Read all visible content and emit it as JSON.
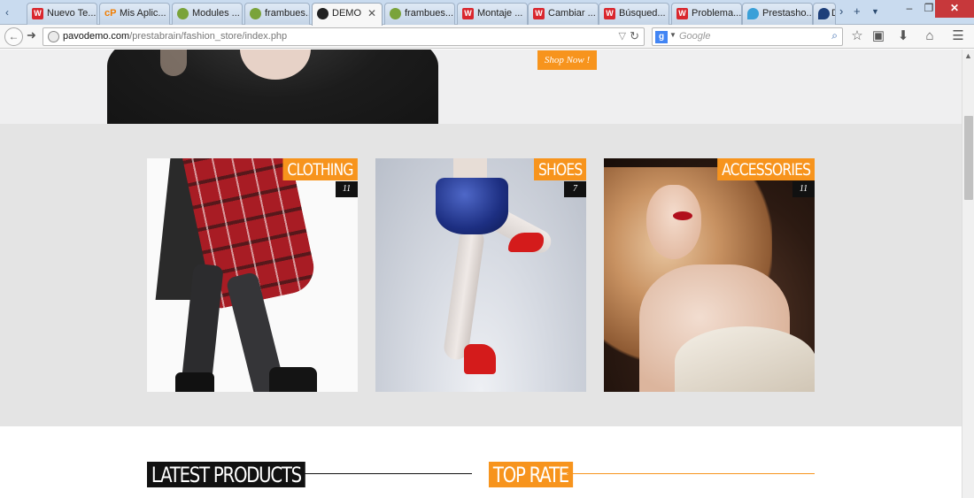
{
  "browser": {
    "tabs": [
      {
        "label": "Nuevo Te...",
        "icon": "w-icon",
        "active": false
      },
      {
        "label": "Mis Aplic...",
        "icon": "cpanel-icon",
        "active": false
      },
      {
        "label": "Modules ...",
        "icon": "raspberry-icon",
        "active": false
      },
      {
        "label": "frambues...",
        "icon": "raspberry-icon",
        "active": false
      },
      {
        "label": "DEMO",
        "icon": "demo-icon",
        "active": true
      },
      {
        "label": "frambues...",
        "icon": "raspberry-icon",
        "active": false
      },
      {
        "label": "Montaje ...",
        "icon": "w-icon",
        "active": false
      },
      {
        "label": "Cambiar ...",
        "icon": "w-icon",
        "active": false
      },
      {
        "label": "Búsqued...",
        "icon": "w-icon",
        "active": false
      },
      {
        "label": "Problema...",
        "icon": "w-icon",
        "active": false
      },
      {
        "label": "Prestasho...",
        "icon": "heart-icon",
        "active": false
      },
      {
        "label": "D",
        "icon": "drop-icon",
        "active": false
      }
    ],
    "url_domain": "pavodemo.com",
    "url_path": "/prestabrain/fashion_store/index.php",
    "search_placeholder": "Google",
    "search_engine_letter": "g"
  },
  "hero": {
    "shop_button": "Shop Now !"
  },
  "categories": [
    {
      "title": "CLOTHING",
      "count": "11"
    },
    {
      "title": "SHOES",
      "count": "7"
    },
    {
      "title": "ACCESSORIES",
      "count": "11"
    }
  ],
  "sections": {
    "latest": "LATEST PRODUCTS",
    "top_rate": "TOP RATE"
  },
  "colors": {
    "accent": "#f7941d",
    "dark": "#111111",
    "band": "#e4e4e4"
  }
}
